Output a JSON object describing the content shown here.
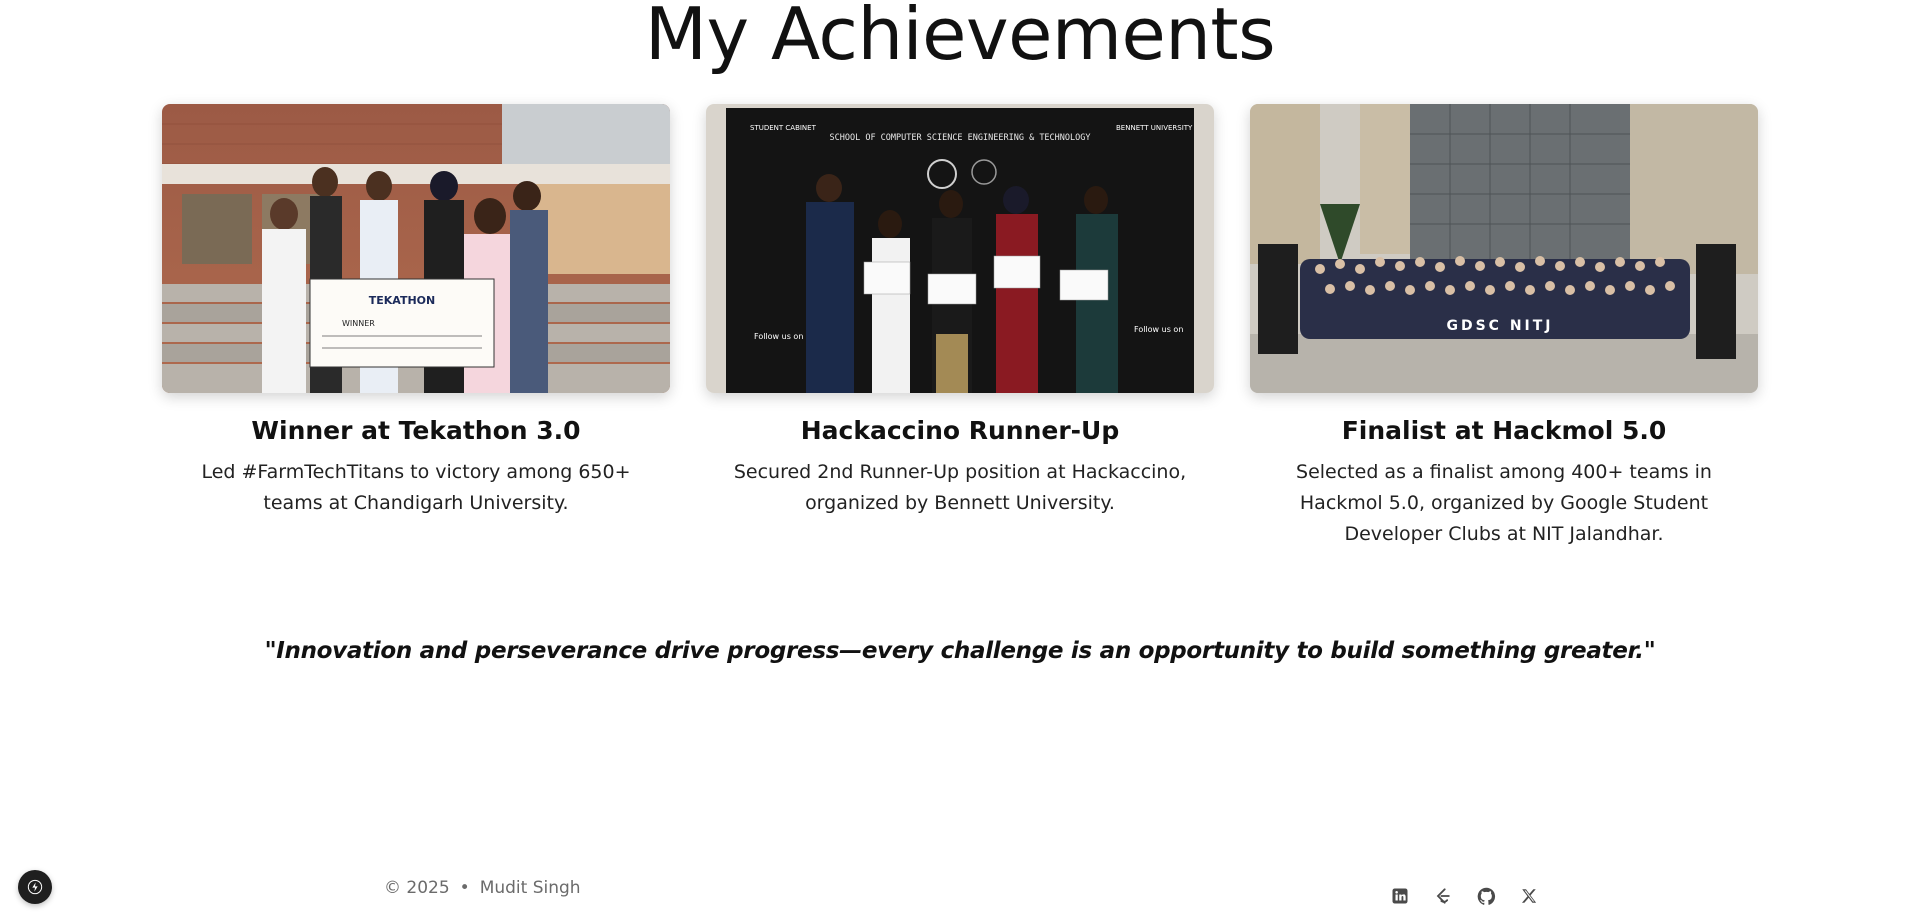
{
  "section": {
    "title": "My Achievements"
  },
  "achievements": [
    {
      "title": "Winner at Tekathon 3.0",
      "description": "Led #FarmTechTitans to victory among 650+ teams at Chandigarh University.",
      "image_alt": "team-photo-with-winner-cheque",
      "image_text": {
        "banner": "TEKATHON",
        "line": "WINNER"
      }
    },
    {
      "title": "Hackaccino Runner-Up",
      "description": "Secured 2nd Runner-Up position at Hackaccino, organized by Bennett University.",
      "image_alt": "team-receiving-certificates-on-stage",
      "image_text": {
        "header": "SCHOOL OF COMPUTER SCIENCE ENGINEERING & TECHNOLOGY",
        "logo_left": "STUDENT CABINET",
        "logo_right": "BENNETT UNIVERSITY"
      }
    },
    {
      "title": "Finalist at Hackmol 5.0",
      "description": "Selected as a finalist among 400+ teams in Hackmol 5.0, organized by Google Student Developer Clubs at NIT Jalandhar.",
      "image_alt": "large-group-photo-outside-building",
      "image_text": {
        "banner": "GDSC NITJ"
      }
    }
  ],
  "quote": "\"Innovation and perseverance drive progress—every challenge is an opportunity to build something greater.\"",
  "footer": {
    "copyright": "© 2025",
    "separator": "•",
    "name": "Mudit Singh",
    "social_icons": [
      "linkedin-icon",
      "leetcode-icon",
      "github-icon",
      "x-icon"
    ]
  },
  "colors": {
    "text": "#111111",
    "muted": "#6b6b6b",
    "badge": "#1f1f1f"
  }
}
